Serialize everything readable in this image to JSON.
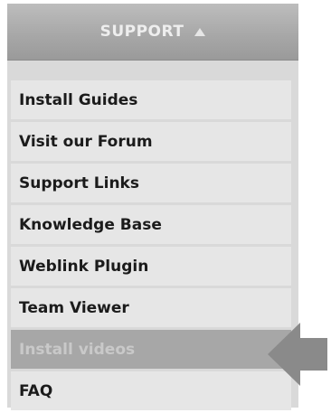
{
  "header": {
    "label": "SUPPORT",
    "caret_icon": "caret-up-icon"
  },
  "menu": {
    "items": [
      {
        "label": "Install Guides"
      },
      {
        "label": "Visit our Forum"
      },
      {
        "label": "Support Links"
      },
      {
        "label": "Knowledge Base"
      },
      {
        "label": "Weblink Plugin"
      },
      {
        "label": "Team Viewer"
      },
      {
        "label": "Install videos",
        "highlighted": true
      },
      {
        "label": "FAQ"
      }
    ]
  },
  "pointer": {
    "icon": "left-arrow-icon",
    "color": "#8a8a8a"
  },
  "colors": {
    "header_bg": "#a8a8a8",
    "item_bg": "#e6e6e6",
    "item_active_bg": "#a7a7a7",
    "item_text": "#1b1b1b",
    "item_active_text": "#c9c9c9"
  }
}
